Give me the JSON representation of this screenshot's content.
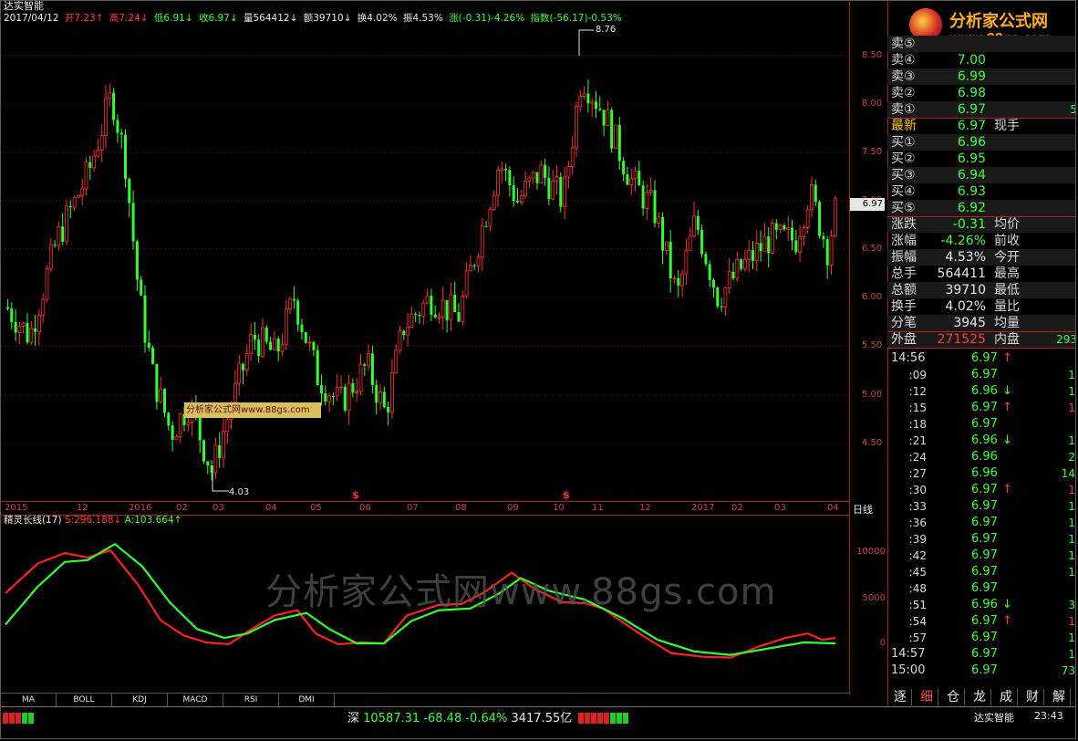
{
  "app": {
    "name": "达实智能"
  },
  "header": {
    "date": "2017/04/12",
    "open": "开7.23↑",
    "high": "高7.24↓",
    "low": "低6.91↓",
    "close": "收6.97↓",
    "volume": "量564412↓",
    "amount": "额39710↓",
    "turnover": "换4.02%",
    "amplitude": "振4.53%",
    "change": "涨(-0.31)-4.26%",
    "index": "指数(-56.17)-0.53%"
  },
  "price_axis": [
    "8.50",
    "8.00",
    "7.50",
    "7.00",
    "6.50",
    "6.00",
    "5.50",
    "5.00",
    "4.50"
  ],
  "last_price_tag": "6.97",
  "annotations": {
    "high_mark": "8.76",
    "low_mark": "4.03"
  },
  "chart_watermark": "分析家公式网www.88gs.com",
  "date_axis": [
    "2015",
    "12",
    "2016",
    "02",
    "03",
    "04",
    "05",
    "06",
    "07",
    "08",
    "09",
    "10",
    "11",
    "12",
    "2017",
    "02",
    "03",
    "04"
  ],
  "period_label": "日线",
  "indicator": {
    "name": "精灵长线(17)",
    "s_label": "S:296.188↓",
    "a_label": "A:103.664↑",
    "axis": [
      "10000",
      "5000",
      "0"
    ]
  },
  "big_watermark": "分析家公式网www.88gs.com",
  "tabs": [
    "MA",
    "BOLL",
    "KDJ",
    "MACD",
    "RSI",
    "DMI"
  ],
  "status": {
    "index_text": "深 10587.31 -68.48 -0.64% 3417.55亿",
    "company": "达实智能",
    "clock": "23:43"
  },
  "logo": {
    "cn": "分析家公式网",
    "url": "www.88gs.com"
  },
  "quote": {
    "sell": [
      {
        "label": "卖⑤",
        "price": "",
        "edge": ""
      },
      {
        "label": "卖④",
        "price": "7.00",
        "edge": ""
      },
      {
        "label": "卖③",
        "price": "6.99",
        "edge": ""
      },
      {
        "label": "卖②",
        "price": "6.98",
        "edge": ""
      },
      {
        "label": "卖①",
        "price": "6.97",
        "edge": "5"
      }
    ],
    "latest": {
      "label": "最新",
      "price": "6.97",
      "extra": "现手"
    },
    "buy": [
      {
        "label": "买①",
        "price": "6.96"
      },
      {
        "label": "买②",
        "price": "6.95"
      },
      {
        "label": "买③",
        "price": "6.94"
      },
      {
        "label": "买④",
        "price": "6.93"
      },
      {
        "label": "买⑤",
        "price": "6.92"
      }
    ],
    "stats": [
      {
        "label": "涨跌",
        "value": "-0.31",
        "extra": "均价"
      },
      {
        "label": "涨幅",
        "value": "-4.26%",
        "extra": "前收"
      },
      {
        "label": "振幅",
        "value": "4.53%",
        "extra": "今开"
      },
      {
        "label": "总手",
        "value": "564411",
        "extra": "最高"
      },
      {
        "label": "总额",
        "value": "39710",
        "extra": "最低"
      },
      {
        "label": "换手",
        "value": "4.02%",
        "extra": "量比"
      },
      {
        "label": "分笔",
        "value": "3945",
        "extra": "均量"
      }
    ],
    "outer": {
      "label": "外盘",
      "value": "271525",
      "extra": "内盘",
      "edge": "293"
    }
  },
  "ticks": [
    {
      "time": "14:56",
      "price": "6.97",
      "dir": "up",
      "vol": ""
    },
    {
      "time": ":09",
      "price": "6.97",
      "dir": "",
      "vol": "1"
    },
    {
      "time": ":12",
      "price": "6.96",
      "dir": "down",
      "vol": "1"
    },
    {
      "time": ":15",
      "price": "6.97",
      "dir": "up",
      "vol": "1"
    },
    {
      "time": ":18",
      "price": "6.97",
      "dir": "",
      "vol": ""
    },
    {
      "time": ":21",
      "price": "6.96",
      "dir": "down",
      "vol": "1"
    },
    {
      "time": ":24",
      "price": "6.96",
      "dir": "",
      "vol": "2"
    },
    {
      "time": ":27",
      "price": "6.96",
      "dir": "",
      "vol": "14"
    },
    {
      "time": ":30",
      "price": "6.97",
      "dir": "up",
      "vol": "1"
    },
    {
      "time": ":33",
      "price": "6.97",
      "dir": "",
      "vol": "1"
    },
    {
      "time": ":36",
      "price": "6.97",
      "dir": "",
      "vol": "1"
    },
    {
      "time": ":39",
      "price": "6.97",
      "dir": "",
      "vol": "1"
    },
    {
      "time": ":42",
      "price": "6.97",
      "dir": "",
      "vol": "1"
    },
    {
      "time": ":45",
      "price": "6.97",
      "dir": "",
      "vol": "1"
    },
    {
      "time": ":48",
      "price": "6.97",
      "dir": "",
      "vol": ""
    },
    {
      "time": ":51",
      "price": "6.96",
      "dir": "down",
      "vol": "3"
    },
    {
      "time": ":54",
      "price": "6.97",
      "dir": "up",
      "vol": "1"
    },
    {
      "time": ":57",
      "price": "6.97",
      "dir": "",
      "vol": "1"
    },
    {
      "time": "14:57",
      "price": "6.97",
      "dir": "",
      "vol": "1"
    },
    {
      "time": "15:00",
      "price": "6.97",
      "dir": "",
      "vol": "73"
    }
  ],
  "right_tabs": [
    "逐",
    "细",
    "仓",
    "龙",
    "成",
    "财",
    "解"
  ],
  "colors": {
    "up": "#ff3b3b",
    "down": "#3cff3c",
    "axis": "#b02020",
    "s_line": "#ff2020",
    "a_line": "#30ff30"
  }
}
